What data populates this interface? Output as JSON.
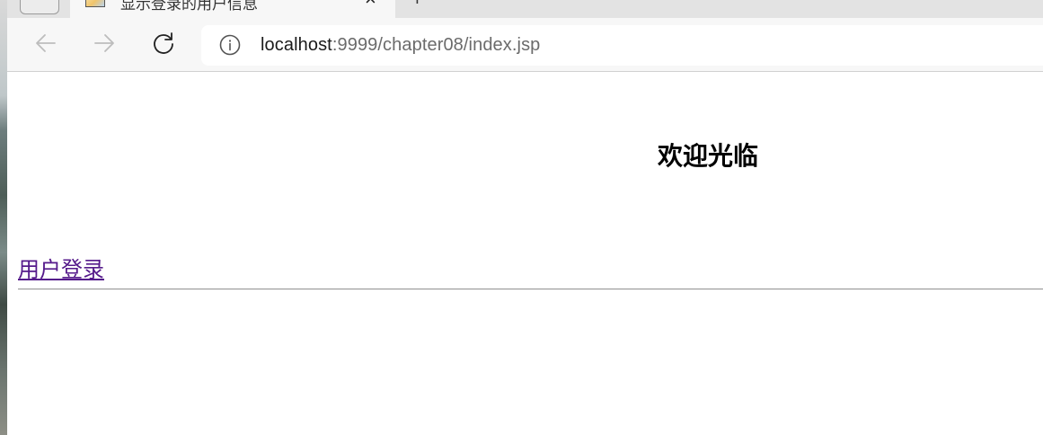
{
  "browser": {
    "tab_title": "显示登录的用户信息",
    "url_host": "localhost",
    "url_path": ":9999/chapter08/index.jsp",
    "icons": [
      "tab-actions-icon",
      "favicon-icon",
      "close-icon",
      "new-tab-icon",
      "back-icon",
      "forward-icon",
      "refresh-icon",
      "info-icon"
    ]
  },
  "page": {
    "heading": "欢迎光临",
    "login_link": "用户登录",
    "link_color": "#551a8b"
  }
}
